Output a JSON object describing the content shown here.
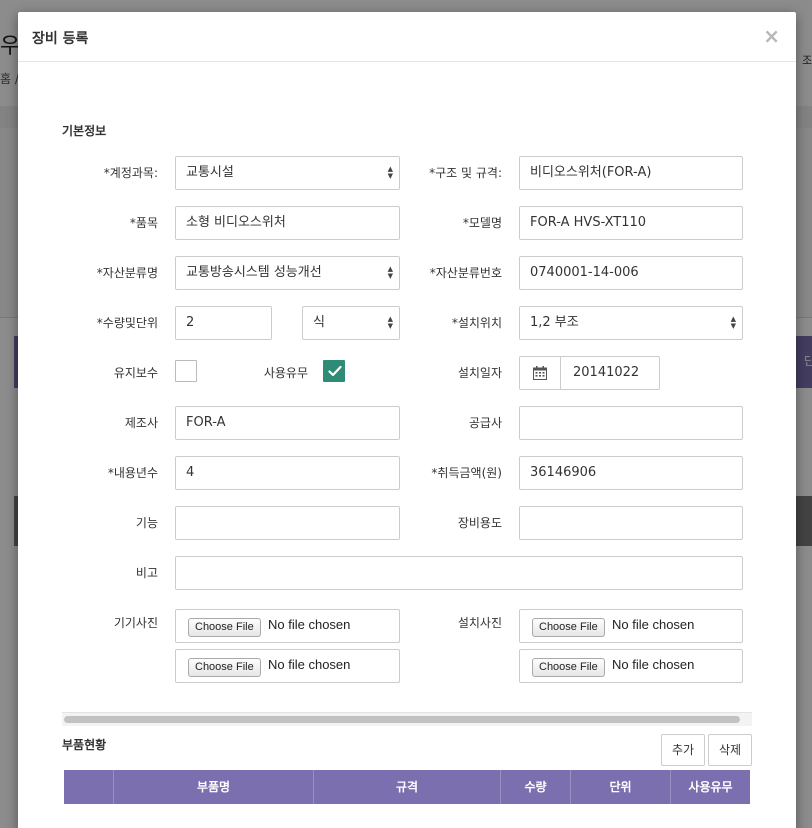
{
  "background": {
    "title_fragment": "우",
    "crumb_fragment": "홈 /",
    "right_fragment": "조",
    "dot1": "",
    "dot2": "",
    "purple_fragment": "단"
  },
  "modal": {
    "title": "장비 등록",
    "close": "×"
  },
  "section": {
    "basic_info": "기본정보"
  },
  "form": {
    "account_label": "*계정과목:",
    "account_value": "교통시설",
    "spec_label": "*구조 및 규격:",
    "spec_value": "비디오스위처(FOR-A)",
    "item_label": "*품목",
    "item_value": "소형 비디오스위처",
    "model_label": "*모델명",
    "model_value": "FOR-A HVS-XT110",
    "asset_class_label": "*자산분류명",
    "asset_class_value": "교통방송시스템 성능개선",
    "asset_no_label": "*자산분류번호",
    "asset_no_value": "0740001-14-006",
    "qty_label": "*수량및단위",
    "qty_value": "2",
    "unit_value": "식",
    "location_label": "*설치위치",
    "location_value": "1,2 부조",
    "maintenance_label": "유지보수",
    "maintenance_checked": false,
    "use_label": "사용유무",
    "use_checked": true,
    "install_date_label": "설치일자",
    "install_date_value": "20141022",
    "maker_label": "제조사",
    "maker_value": "FOR-A",
    "supplier_label": "공급사",
    "supplier_value": "",
    "lifespan_label": "*내용년수",
    "lifespan_value": "4",
    "amount_label": "*취득금액(원)",
    "amount_value": "36146906",
    "function_label": "기능",
    "function_value": "",
    "purpose_label": "장비용도",
    "purpose_value": "",
    "note_label": "비고",
    "note_value": "",
    "device_photo_label": "기기사진",
    "install_photo_label": "설치사진",
    "file_button": "Choose File",
    "file_status": "No file chosen"
  },
  "parts": {
    "title": "부품현황",
    "add_button": "추가",
    "delete_button": "삭제",
    "columns": [
      "",
      "부품명",
      "규격",
      "수량",
      "단위",
      "사용유무"
    ]
  },
  "colors": {
    "accent_purple": "#7b6fb0",
    "check_green": "#2e8b76"
  }
}
